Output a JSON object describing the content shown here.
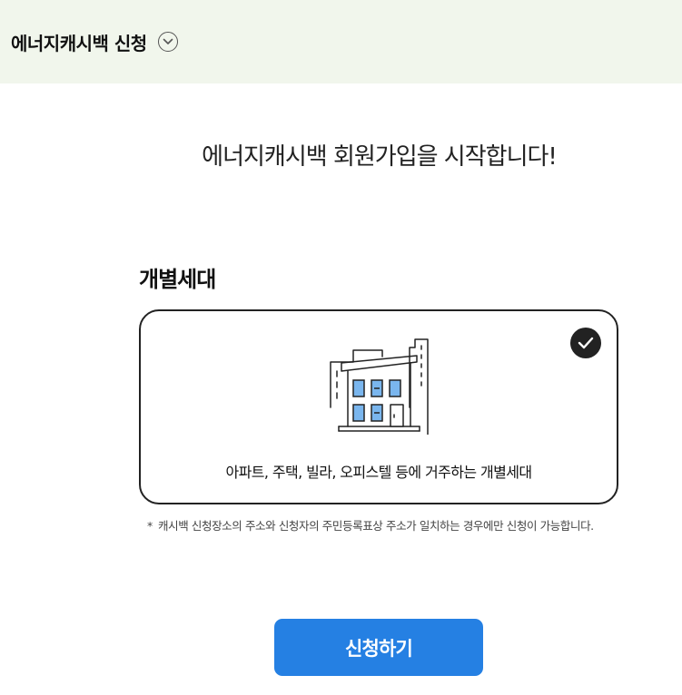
{
  "header": {
    "title": "에너지캐시백 신청",
    "toggle_icon": "chevron-down-circle-icon"
  },
  "main": {
    "welcome_text": "에너지캐시백 회원가입을 시작합니다!",
    "section_title": "개별세대",
    "option": {
      "icon": "building-icon",
      "selected": true,
      "check_icon": "check-circle-icon",
      "description": "아파트, 주택, 빌라, 오피스텔 등에 거주하는 개별세대"
    },
    "notice": {
      "mark": "*",
      "text": "캐시백 신청장소의 주소와 신청자의 주민등록표상 주소가 일치하는 경우에만 신청이 가능합니다."
    },
    "apply_button": "신청하기"
  },
  "colors": {
    "header_bg": "#f1f6ec",
    "primary_button": "#2580e3",
    "window_blue": "#7ab6ee",
    "card_border": "#222222"
  }
}
